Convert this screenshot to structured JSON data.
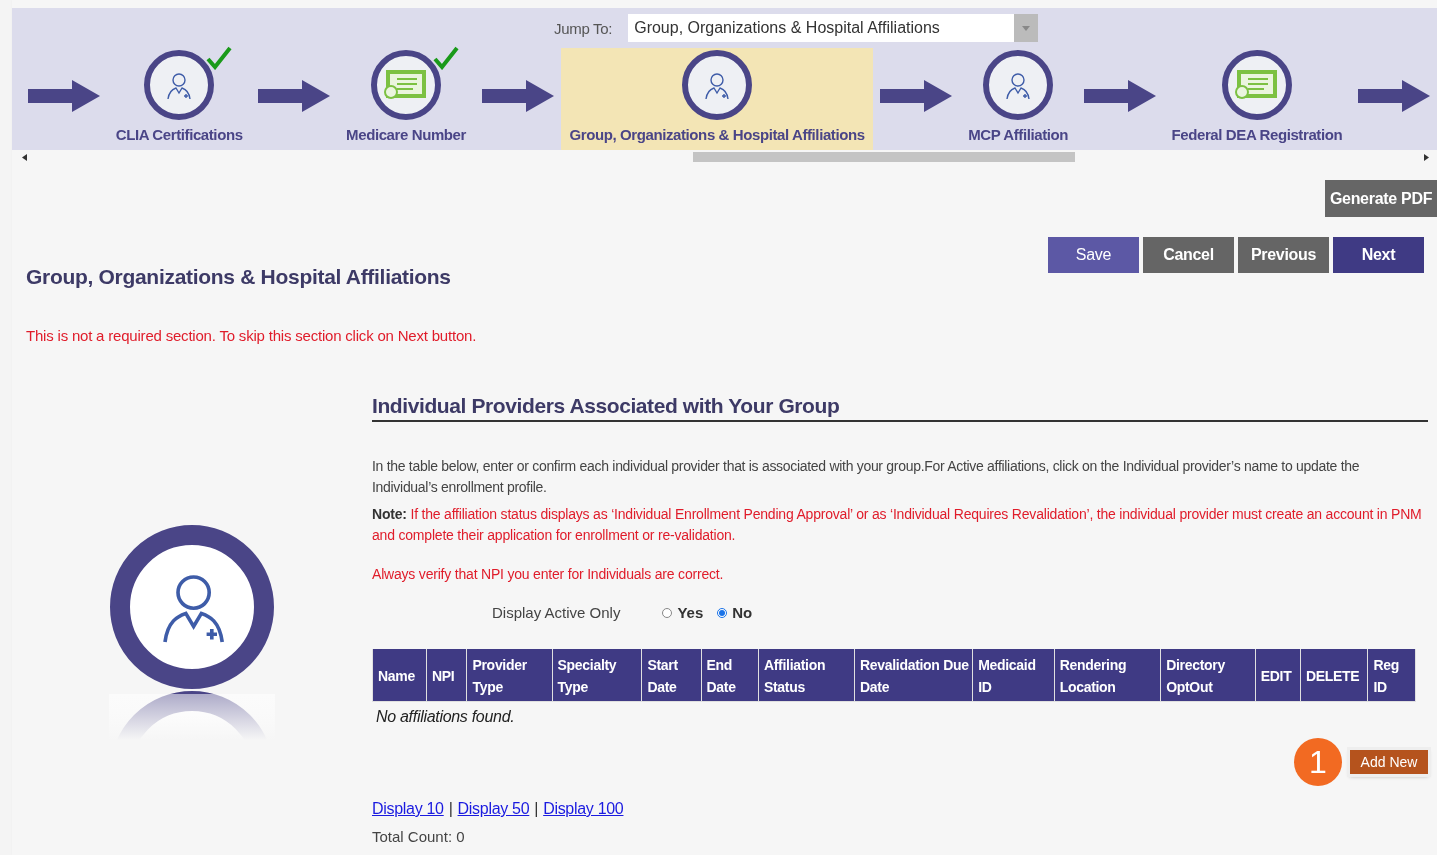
{
  "jump_to": {
    "label": "Jump To:",
    "value": "Group, Organizations & Hospital Affiliations"
  },
  "steps": [
    {
      "label": "CLIA Certifications",
      "kind": "person",
      "completed": true,
      "selected": false
    },
    {
      "label": "Medicare Number",
      "kind": "certificate",
      "completed": true,
      "selected": false
    },
    {
      "label": "Group, Organizations & Hospital Affiliations",
      "kind": "person",
      "completed": false,
      "selected": true
    },
    {
      "label": "MCP Affiliation",
      "kind": "person",
      "completed": false,
      "selected": false
    },
    {
      "label": "Federal DEA Registration",
      "kind": "certificate",
      "completed": false,
      "selected": false
    }
  ],
  "generate_pdf": "Generate PDF",
  "buttons": [
    {
      "label": "Save",
      "kind": "primary-light"
    },
    {
      "label": "Cancel",
      "kind": "secondary"
    },
    {
      "label": "Previous",
      "kind": "secondary"
    },
    {
      "label": "Next",
      "kind": "primary"
    }
  ],
  "page_title": "Group, Organizations & Hospital Affiliations",
  "optional_note": "This is not a required section. To skip this section click on Next button.",
  "section": {
    "title": "Individual Providers Associated with Your Group",
    "intro": "In the table below, enter or confirm each individual provider that is associated with your group.For Active affiliations, click on the Individual provider’s name to update the Individual’s enrollment profile.",
    "note": "**Note:** If the affiliation status displays as ‘Individual Enrollment Pending Approval’ or as ‘Individual Requires Revalidation’, the individual provider must create an account in PNM and complete their application for enrollment or re-validation.",
    "warning": "Always verify that NPI you enter for Individuals are correct.",
    "filter": {
      "label": "Display Active Only",
      "options": [
        {
          "label": "Yes",
          "selected": false
        },
        {
          "label": "No",
          "selected": true
        }
      ]
    }
  },
  "table": {
    "columns": [
      "Name",
      "NPI",
      "Provider Type",
      "Specialty Type",
      "Start Date",
      "End Date",
      "Affiliation Status",
      "Revalidation Due Date",
      "Medicaid ID",
      "Rendering Location",
      "Directory OptOut",
      "EDIT",
      "DELETE",
      "Reg ID"
    ],
    "empty_message": "No affiliations found."
  },
  "callout": "1",
  "add_new": "Add New",
  "paging": [
    {
      "kind": "link",
      "text": "Display 10"
    },
    {
      "kind": "separator",
      "text": "|"
    },
    {
      "kind": "link",
      "text": "Display 50"
    },
    {
      "kind": "separator",
      "text": "|"
    },
    {
      "kind": "link",
      "text": "Display 100"
    }
  ],
  "total_count": "Total Count: 0"
}
